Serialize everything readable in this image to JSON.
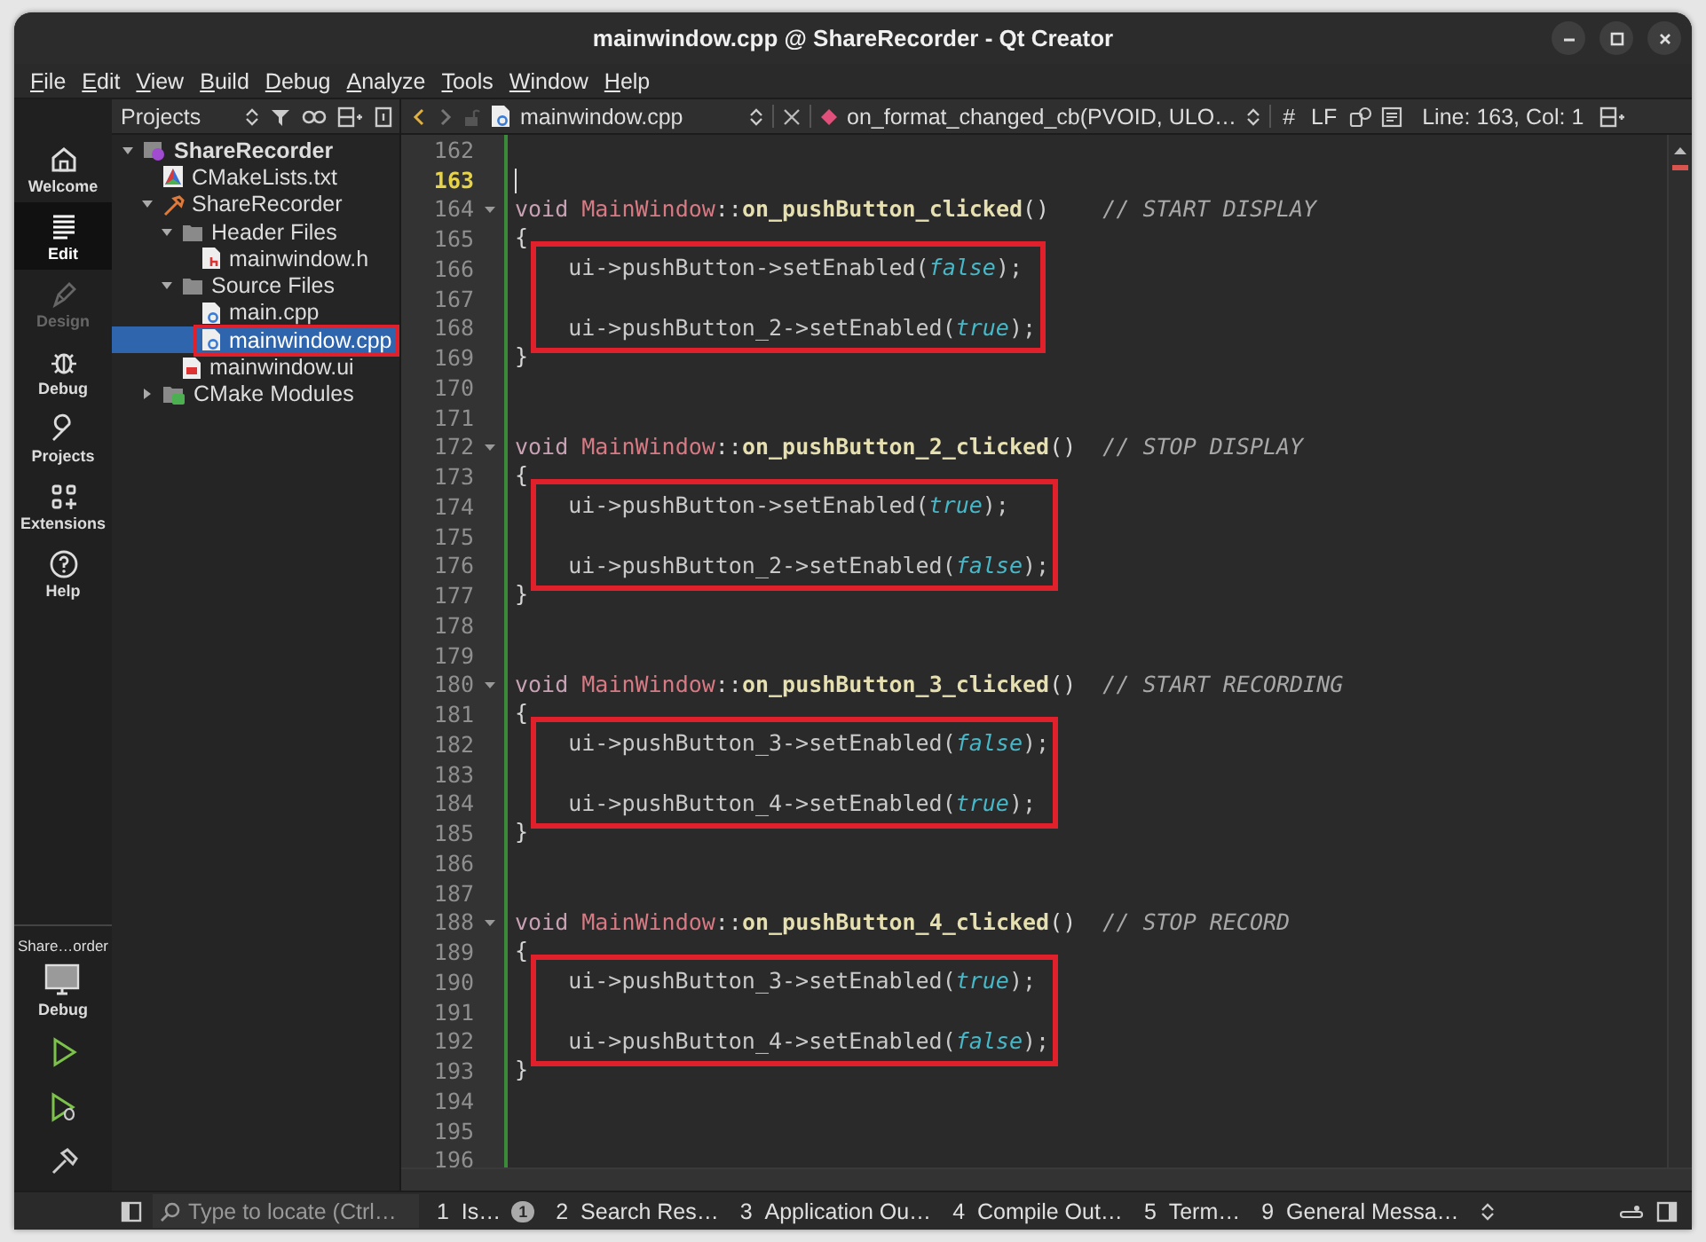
{
  "window": {
    "title": "mainwindow.cpp @ ShareRecorder - Qt Creator"
  },
  "menu": [
    "File",
    "Edit",
    "View",
    "Build",
    "Debug",
    "Analyze",
    "Tools",
    "Window",
    "Help"
  ],
  "mode_bar": {
    "items": [
      {
        "label": "Welcome",
        "kind": "welcome",
        "selected": false,
        "disabled": false
      },
      {
        "label": "Edit",
        "kind": "edit",
        "selected": true,
        "disabled": false
      },
      {
        "label": "Design",
        "kind": "design",
        "selected": false,
        "disabled": true
      },
      {
        "label": "Debug",
        "kind": "debug",
        "selected": false,
        "disabled": false
      },
      {
        "label": "Projects",
        "kind": "projects",
        "selected": false,
        "disabled": false
      },
      {
        "label": "Extensions",
        "kind": "extensions",
        "selected": false,
        "disabled": false
      },
      {
        "label": "Help",
        "kind": "help",
        "selected": false,
        "disabled": false
      }
    ],
    "kit": {
      "project": "Share…order",
      "label": "Debug"
    },
    "actions": [
      {
        "kind": "run"
      },
      {
        "kind": "debug-run"
      },
      {
        "kind": "build"
      }
    ]
  },
  "projects_panel": {
    "title": "Projects",
    "tree": [
      {
        "label": "ShareRecorder",
        "kind": "project",
        "expanded": true,
        "selected": false,
        "annotated": false,
        "children": [
          {
            "label": "CMakeLists.txt",
            "kind": "cmake",
            "selected": false,
            "annotated": false
          },
          {
            "label": "ShareRecorder",
            "kind": "target",
            "expanded": true,
            "selected": false,
            "annotated": false,
            "children": [
              {
                "label": "Header Files",
                "kind": "folder",
                "expanded": true,
                "selected": false,
                "annotated": false,
                "children": [
                  {
                    "label": "mainwindow.h",
                    "kind": "header",
                    "selected": false,
                    "annotated": false
                  }
                ]
              },
              {
                "label": "Source Files",
                "kind": "folder",
                "expanded": true,
                "selected": false,
                "annotated": false,
                "children": [
                  {
                    "label": "main.cpp",
                    "kind": "source",
                    "selected": false,
                    "annotated": false
                  },
                  {
                    "label": "mainwindow.cpp",
                    "kind": "source",
                    "selected": true,
                    "annotated": true
                  }
                ]
              },
              {
                "label": "mainwindow.ui",
                "kind": "form",
                "selected": false,
                "annotated": false
              }
            ]
          },
          {
            "label": "CMake Modules",
            "kind": "modules",
            "expanded": false,
            "selected": false,
            "annotated": false
          }
        ]
      }
    ]
  },
  "editor": {
    "file": "mainwindow.cpp",
    "symbol": "on_format_changed_cb(PVOID, ULO…",
    "hash": "#",
    "line_ending": "LF",
    "position": "Line: 163, Col: 1",
    "lines": [
      {
        "number": "162",
        "current": false,
        "foldable": false,
        "boxed": false
      },
      {
        "number": "163",
        "current": true,
        "foldable": false,
        "boxed": false
      },
      {
        "number": "164",
        "current": false,
        "foldable": true,
        "boxed": false,
        "tokens": [
          {
            "kind": "kw",
            "text": "void "
          },
          {
            "kind": "type",
            "text": "MainWindow"
          },
          {
            "kind": "op",
            "text": "::"
          },
          {
            "kind": "fn",
            "text": "on_pushButton_clicked"
          },
          {
            "kind": "op",
            "text": "()    "
          },
          {
            "kind": "comment",
            "text": "// START DISPLAY"
          }
        ]
      },
      {
        "number": "165",
        "current": false,
        "foldable": false,
        "boxed": false,
        "tokens": [
          {
            "kind": "op",
            "text": "{"
          }
        ]
      },
      {
        "number": "166",
        "current": false,
        "foldable": false,
        "boxed": true,
        "tokens": [
          {
            "kind": "plain",
            "text": "    ui->pushButton->setEnabled("
          },
          {
            "kind": "bool",
            "text": "false"
          },
          {
            "kind": "plain",
            "text": ");"
          }
        ]
      },
      {
        "number": "167",
        "current": false,
        "foldable": false,
        "boxed": true
      },
      {
        "number": "168",
        "current": false,
        "foldable": false,
        "boxed": true,
        "tokens": [
          {
            "kind": "plain",
            "text": "    ui->pushButton_2->setEnabled("
          },
          {
            "kind": "bool",
            "text": "true"
          },
          {
            "kind": "plain",
            "text": ");"
          }
        ]
      },
      {
        "number": "169",
        "current": false,
        "foldable": false,
        "boxed": false,
        "tokens": [
          {
            "kind": "op",
            "text": "}"
          }
        ]
      },
      {
        "number": "170",
        "current": false,
        "foldable": false,
        "boxed": false
      },
      {
        "number": "171",
        "current": false,
        "foldable": false,
        "boxed": false
      },
      {
        "number": "172",
        "current": false,
        "foldable": true,
        "boxed": false,
        "tokens": [
          {
            "kind": "kw",
            "text": "void "
          },
          {
            "kind": "type",
            "text": "MainWindow"
          },
          {
            "kind": "op",
            "text": "::"
          },
          {
            "kind": "fn",
            "text": "on_pushButton_2_clicked"
          },
          {
            "kind": "op",
            "text": "()  "
          },
          {
            "kind": "comment",
            "text": "// STOP DISPLAY"
          }
        ]
      },
      {
        "number": "173",
        "current": false,
        "foldable": false,
        "boxed": false,
        "tokens": [
          {
            "kind": "op",
            "text": "{"
          }
        ]
      },
      {
        "number": "174",
        "current": false,
        "foldable": false,
        "boxed": true,
        "tokens": [
          {
            "kind": "plain",
            "text": "    ui->pushButton->setEnabled("
          },
          {
            "kind": "bool",
            "text": "true"
          },
          {
            "kind": "plain",
            "text": ");"
          }
        ]
      },
      {
        "number": "175",
        "current": false,
        "foldable": false,
        "boxed": true
      },
      {
        "number": "176",
        "current": false,
        "foldable": false,
        "boxed": true,
        "tokens": [
          {
            "kind": "plain",
            "text": "    ui->pushButton_2->setEnabled("
          },
          {
            "kind": "bool",
            "text": "false"
          },
          {
            "kind": "plain",
            "text": ");"
          }
        ]
      },
      {
        "number": "177",
        "current": false,
        "foldable": false,
        "boxed": false,
        "tokens": [
          {
            "kind": "op",
            "text": "}"
          }
        ]
      },
      {
        "number": "178",
        "current": false,
        "foldable": false,
        "boxed": false
      },
      {
        "number": "179",
        "current": false,
        "foldable": false,
        "boxed": false
      },
      {
        "number": "180",
        "current": false,
        "foldable": true,
        "boxed": false,
        "tokens": [
          {
            "kind": "kw",
            "text": "void "
          },
          {
            "kind": "type",
            "text": "MainWindow"
          },
          {
            "kind": "op",
            "text": "::"
          },
          {
            "kind": "fn",
            "text": "on_pushButton_3_clicked"
          },
          {
            "kind": "op",
            "text": "()  "
          },
          {
            "kind": "comment",
            "text": "// START RECORDING"
          }
        ]
      },
      {
        "number": "181",
        "current": false,
        "foldable": false,
        "boxed": false,
        "tokens": [
          {
            "kind": "op",
            "text": "{"
          }
        ]
      },
      {
        "number": "182",
        "current": false,
        "foldable": false,
        "boxed": true,
        "tokens": [
          {
            "kind": "plain",
            "text": "    ui->pushButton_3->setEnabled("
          },
          {
            "kind": "bool",
            "text": "false"
          },
          {
            "kind": "plain",
            "text": ");"
          }
        ]
      },
      {
        "number": "183",
        "current": false,
        "foldable": false,
        "boxed": true
      },
      {
        "number": "184",
        "current": false,
        "foldable": false,
        "boxed": true,
        "tokens": [
          {
            "kind": "plain",
            "text": "    ui->pushButton_4->setEnabled("
          },
          {
            "kind": "bool",
            "text": "true"
          },
          {
            "kind": "plain",
            "text": ");"
          }
        ]
      },
      {
        "number": "185",
        "current": false,
        "foldable": false,
        "boxed": false,
        "tokens": [
          {
            "kind": "op",
            "text": "}"
          }
        ]
      },
      {
        "number": "186",
        "current": false,
        "foldable": false,
        "boxed": false
      },
      {
        "number": "187",
        "current": false,
        "foldable": false,
        "boxed": false
      },
      {
        "number": "188",
        "current": false,
        "foldable": true,
        "boxed": false,
        "tokens": [
          {
            "kind": "kw",
            "text": "void "
          },
          {
            "kind": "type",
            "text": "MainWindow"
          },
          {
            "kind": "op",
            "text": "::"
          },
          {
            "kind": "fn",
            "text": "on_pushButton_4_clicked"
          },
          {
            "kind": "op",
            "text": "()  "
          },
          {
            "kind": "comment",
            "text": "// STOP RECORD"
          }
        ]
      },
      {
        "number": "189",
        "current": false,
        "foldable": false,
        "boxed": false,
        "tokens": [
          {
            "kind": "op",
            "text": "{"
          }
        ]
      },
      {
        "number": "190",
        "current": false,
        "foldable": false,
        "boxed": true,
        "tokens": [
          {
            "kind": "plain",
            "text": "    ui->pushButton_3->setEnabled("
          },
          {
            "kind": "bool",
            "text": "true"
          },
          {
            "kind": "plain",
            "text": ");"
          }
        ]
      },
      {
        "number": "191",
        "current": false,
        "foldable": false,
        "boxed": true
      },
      {
        "number": "192",
        "current": false,
        "foldable": false,
        "boxed": true,
        "tokens": [
          {
            "kind": "plain",
            "text": "    ui->pushButton_4->setEnabled("
          },
          {
            "kind": "bool",
            "text": "false"
          },
          {
            "kind": "plain",
            "text": ");"
          }
        ]
      },
      {
        "number": "193",
        "current": false,
        "foldable": false,
        "boxed": false,
        "tokens": [
          {
            "kind": "op",
            "text": "}"
          }
        ]
      },
      {
        "number": "194",
        "current": false,
        "foldable": false,
        "boxed": false
      },
      {
        "number": "195",
        "current": false,
        "foldable": false,
        "boxed": false
      },
      {
        "number": "196",
        "current": false,
        "foldable": false,
        "boxed": false
      }
    ]
  },
  "locator": {
    "placeholder": "Type to locate (Ctrl…"
  },
  "output_tabs": [
    {
      "number": "1",
      "label": "Is…",
      "badge": "1"
    },
    {
      "number": "2",
      "label": "Search Res…"
    },
    {
      "number": "3",
      "label": "Application Ou…"
    },
    {
      "number": "4",
      "label": "Compile Out…"
    },
    {
      "number": "5",
      "label": "Term…"
    },
    {
      "number": "9",
      "label": "General Messa…"
    }
  ]
}
